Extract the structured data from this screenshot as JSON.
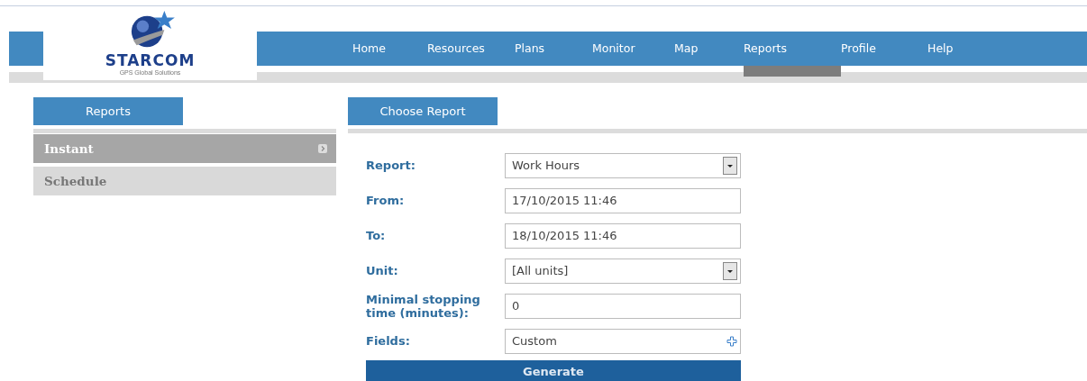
{
  "logo": {
    "name": "STARCOM",
    "tagline": "GPS Global Solutions"
  },
  "nav": [
    {
      "label": "Home",
      "selected": false
    },
    {
      "label": "Resources",
      "selected": false
    },
    {
      "label": "Plans",
      "selected": false
    },
    {
      "label": "Monitor",
      "selected": false
    },
    {
      "label": "Map",
      "selected": false
    },
    {
      "label": "Reports",
      "selected": true
    },
    {
      "label": "Profile",
      "selected": false
    },
    {
      "label": "Help",
      "selected": false
    }
  ],
  "sidebar": {
    "title": "Reports",
    "items": [
      {
        "label": "Instant",
        "selected": true
      },
      {
        "label": "Schedule",
        "selected": false
      }
    ]
  },
  "panel": {
    "tab": "Choose Report",
    "fields": [
      {
        "label": "Report:",
        "kind": "select",
        "value": "Work Hours"
      },
      {
        "label": "From:",
        "kind": "text",
        "value": "17/10/2015 11:46"
      },
      {
        "label": "To:",
        "kind": "text",
        "value": "18/10/2015 11:46"
      },
      {
        "label": "Unit:",
        "kind": "select",
        "value": "[All units]"
      },
      {
        "label": "Minimal stopping time (minutes):",
        "kind": "text",
        "value": "0"
      },
      {
        "label": "Fields:",
        "kind": "picker",
        "value": "Custom"
      }
    ],
    "button": "Generate"
  }
}
